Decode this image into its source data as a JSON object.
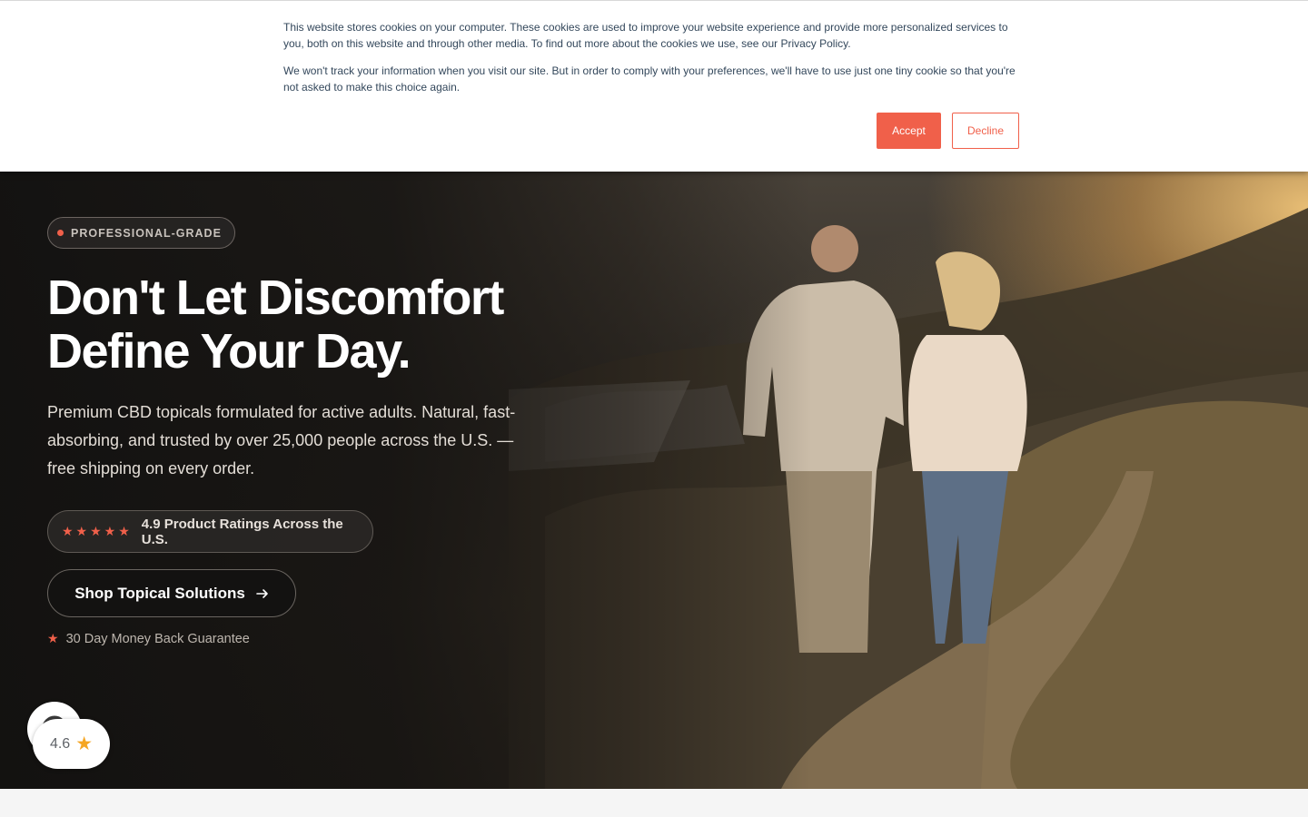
{
  "cookie_banner": {
    "paragraph_1": "This website stores cookies on your computer. These cookies are used to improve your website experience and provide more personalized services to you, both on this website and through other media. To find out more about the cookies we use, see our Privacy Policy.",
    "paragraph_2": "We won't track your information when you visit our site. But in order to comply with your preferences, we'll have to use just one tiny cookie so that you're not asked to make this choice again.",
    "accept_label": "Accept",
    "decline_label": "Decline"
  },
  "hero": {
    "badge": "PROFESSIONAL-GRADE",
    "headline_line_1": "Don't Let Discomfort",
    "headline_line_2": "Define Your Day.",
    "subtext": "Premium CBD topicals formulated for active adults. Natural, fast-absorbing, and trusted by over 25,000 people across the U.S. — free shipping on every order.",
    "rating": {
      "stars": "★★★★★",
      "text": "4.9 Product Ratings Across the U.S."
    },
    "cta_label": "Shop Topical Solutions",
    "cta_icon": "arrow-right-icon",
    "guarantee": "30 Day Money Back Guarantee"
  },
  "review_widget": {
    "score": "4.6",
    "icon": "star-icon"
  },
  "colors": {
    "accent": "#f0604a",
    "banner_text": "#33475b",
    "hero_dark": "#121110",
    "widget_star": "#f5a623"
  }
}
